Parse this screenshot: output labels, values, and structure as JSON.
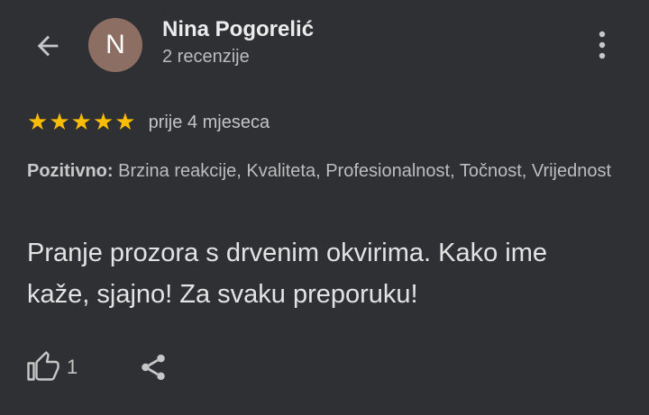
{
  "header": {
    "back_icon": "arrow-back-icon",
    "avatar_letter": "N",
    "avatar_color": "#8d6e63",
    "reviewer_name": "Nina Pogorelić",
    "review_count": "2 recenzije",
    "more_icon": "more-vertical-icon"
  },
  "rating": {
    "stars": 5,
    "max_stars": 5,
    "star_color": "#fbbc04",
    "date": "prije 4 mjeseca"
  },
  "positives": {
    "label": "Pozitivno:",
    "items": "Brzina reakcije, Kvaliteta, Profesionalnost, Točnost, Vrijednost"
  },
  "review_text": "Pranje prozora s drvenim okvirima. Kako ime kaže, sjajno! Za svaku preporuku!",
  "actions": {
    "like_icon": "thumbs-up-icon",
    "like_count": "1",
    "share_icon": "share-icon"
  }
}
